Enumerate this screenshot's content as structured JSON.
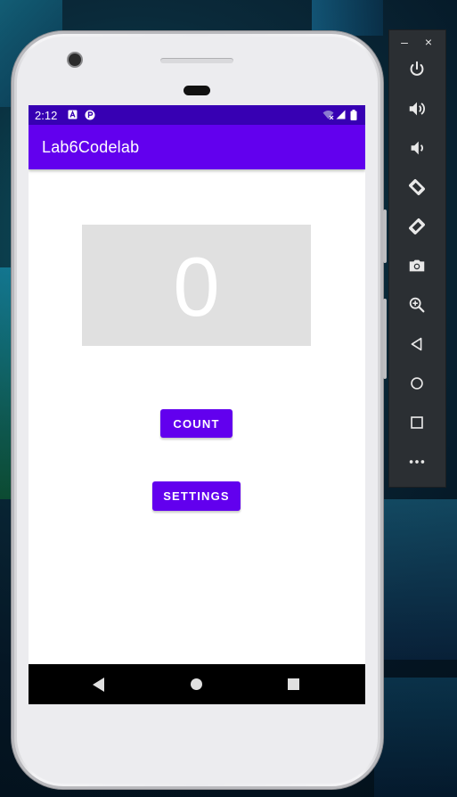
{
  "status_bar": {
    "time": "2:12",
    "left_icons": [
      "a-letter-notification-icon",
      "p-notification-icon"
    ],
    "right_icons": [
      "wifi-icon",
      "signal-icon",
      "battery-icon"
    ]
  },
  "app_bar": {
    "title": "Lab6Codelab"
  },
  "main": {
    "count_value": "0",
    "count_button_label": "COUNT",
    "settings_button_label": "SETTINGS"
  },
  "nav_bar": {
    "buttons": [
      "back",
      "home",
      "recents"
    ]
  },
  "emulator_toolbar": {
    "window_controls": {
      "minimize": "–",
      "close": "×"
    },
    "buttons": [
      "power",
      "volume-up",
      "volume-down",
      "rotate-left",
      "rotate-right",
      "screenshot",
      "zoom",
      "back",
      "home",
      "overview",
      "more"
    ]
  },
  "colors": {
    "primary": "#6200ee",
    "primary_dark": "#3700b3",
    "count_box_bg": "#e0e0e0",
    "nav_bar_bg": "#000000",
    "emulator_panel_bg": "#2b2f33"
  }
}
